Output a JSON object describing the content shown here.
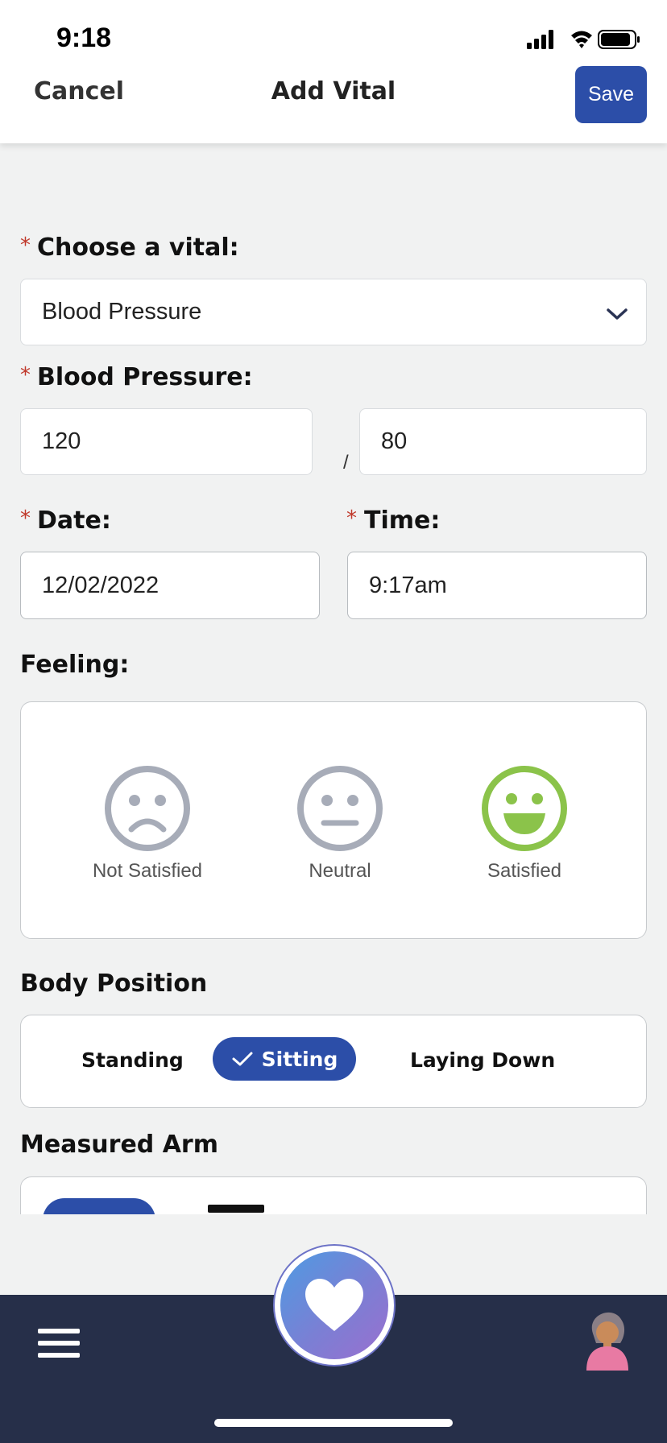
{
  "status_bar": {
    "time": "9:18"
  },
  "header": {
    "cancel_label": "Cancel",
    "title": "Add Vital",
    "save_label": "Save"
  },
  "form": {
    "required_marker": "*",
    "vital": {
      "label": "Choose a vital:",
      "value": "Blood Pressure"
    },
    "blood_pressure": {
      "label": "Blood Pressure:",
      "systolic": "120",
      "separator": "/",
      "diastolic": "80"
    },
    "date": {
      "label": "Date:",
      "value": "12/02/2022"
    },
    "time": {
      "label": "Time:",
      "value": "9:17am"
    },
    "feeling": {
      "label": "Feeling:",
      "options": [
        "Not Satisfied",
        "Neutral",
        "Satisfied"
      ],
      "selected": "Satisfied"
    },
    "body_position": {
      "label": "Body Position",
      "options": [
        "Standing",
        "Sitting",
        "Laying Down"
      ],
      "selected": "Sitting"
    },
    "measured_arm": {
      "label": "Measured Arm"
    }
  },
  "colors": {
    "accent": "#2c4ea8",
    "required": "#c0392b",
    "satisfied_green": "#8bc34a",
    "face_gray": "#a7acb8",
    "nav_bar": "#262f49"
  },
  "icons": {
    "vital_select": "chevron-down-icon",
    "body_position_check": "check-icon",
    "nav_menu": "hamburger-menu-icon",
    "fab": "heart-icon",
    "profile": "avatar-icon"
  }
}
